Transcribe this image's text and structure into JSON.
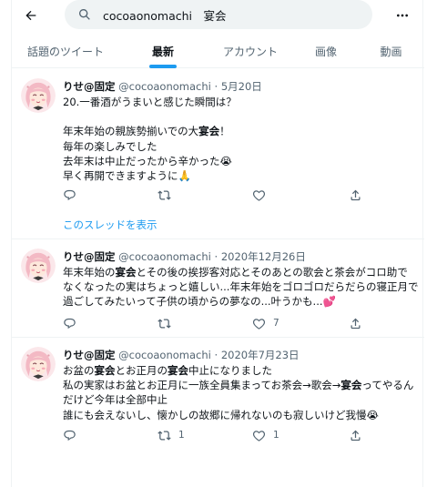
{
  "topbar": {
    "back_icon": "arrow-left-icon",
    "search_value": "cocoaonomachi　宴会",
    "search_icon": "search-icon",
    "more_icon": "more-dots-icon"
  },
  "tabs": [
    {
      "label": "話題のツイート",
      "active": false
    },
    {
      "label": "最新",
      "active": true
    },
    {
      "label": "アカウント",
      "active": false
    },
    {
      "label": "画像",
      "active": false
    },
    {
      "label": "動画",
      "active": false
    }
  ],
  "accent_color": "#1d9bf0",
  "tweets": [
    {
      "name": "りせ@固定",
      "handle": "@cocoaonomachi",
      "sep": " · ",
      "date": "5月20日",
      "lines": [
        [
          "20.一番酒がうまいと感じた瞬間は？"
        ],
        [
          ""
        ],
        [
          "年末年始の親族勢揃いでの大",
          "宴会",
          "！"
        ],
        [
          "毎年の楽しみでした"
        ],
        [
          "去年末は中止だったから辛かった",
          "😭"
        ],
        [
          "早く再開できますように",
          "🙏"
        ]
      ],
      "thread_link": "このスレッドを表示",
      "reply_count": "",
      "retweet_count": "",
      "like_count": ""
    },
    {
      "name": "りせ@固定",
      "handle": "@cocoaonomachi",
      "sep": " · ",
      "date": "2020年12月26日",
      "lines": [
        [
          "年末年始の",
          "宴会",
          "とその後の挨拶客対応とそのあとの歌会と茶会がコロ助で"
        ],
        [
          "なくなったの実はちょっと嬉しい...年末年始をゴロゴロだらだらの寝正月で"
        ],
        [
          "過ごしてみたいって子供の頃からの夢なの...叶うかも...",
          "💕"
        ]
      ],
      "reply_count": "",
      "retweet_count": "",
      "like_count": "7"
    },
    {
      "name": "りせ@固定",
      "handle": "@cocoaonomachi",
      "sep": " · ",
      "date": "2020年7月23日",
      "lines": [
        [
          "お盆の",
          "宴会",
          "とお正月の",
          "宴会",
          "中止になりました"
        ],
        [
          "私の実家はお盆とお正月に一族全員集まってお茶会→歌会→",
          "宴会",
          "ってやるん"
        ],
        [
          "だけど今年は全部中止"
        ],
        [
          "誰にも会えないし、懐かしの故郷に帰れないのも寂しいけど我慢",
          "😭"
        ]
      ],
      "reply_count": "",
      "retweet_count": "1",
      "like_count": "1"
    }
  ]
}
